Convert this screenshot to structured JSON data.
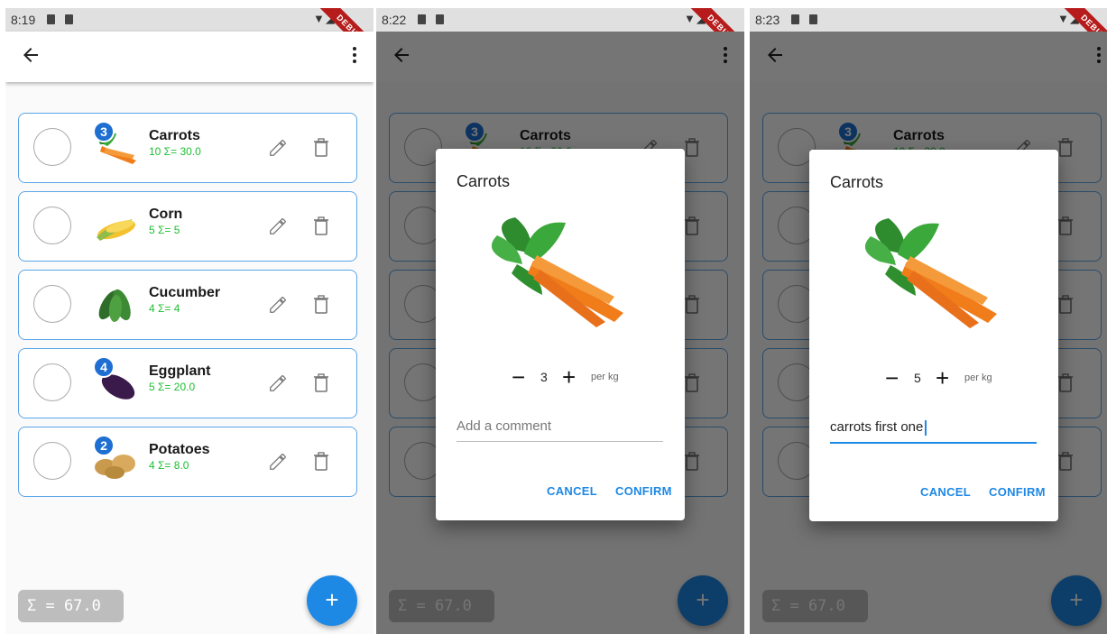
{
  "accent_color": "#1e88e5",
  "debug_banner": "DEBUG",
  "screens": [
    {
      "status_time": "8:19",
      "dimmed": false,
      "items": [
        {
          "name": "Carrots",
          "sub": "10  Σ= 30.0",
          "badge": "3",
          "image": "carrot-image"
        },
        {
          "name": "Corn",
          "sub": "5  Σ= 5",
          "badge": "",
          "image": "corn-image"
        },
        {
          "name": "Cucumber",
          "sub": "4  Σ= 4",
          "badge": "",
          "image": "cucumber-image"
        },
        {
          "name": "Eggplant",
          "sub": "5  Σ= 20.0",
          "badge": "4",
          "image": "eggplant-image"
        },
        {
          "name": "Potatoes",
          "sub": "4  Σ= 8.0",
          "badge": "2",
          "image": "potato-image"
        }
      ],
      "sum_label": "Σ = 67.0",
      "fab_label": "+"
    },
    {
      "status_time": "8:22",
      "dimmed": true,
      "sum_label": "Σ = 67.0",
      "fab_label": "+",
      "dialog": {
        "title": "Carrots",
        "minus": "−",
        "quantity": "3",
        "plus": "+",
        "unit": "per kg",
        "comment_placeholder": "Add a comment",
        "comment_value": "",
        "cancel_label": "CANCEL",
        "confirm_label": "CONFIRM"
      }
    },
    {
      "status_time": "8:23",
      "dimmed": true,
      "sum_label": "Σ = 67.0",
      "fab_label": "+",
      "dialog": {
        "title": "Carrots",
        "minus": "−",
        "quantity": "5",
        "plus": "+",
        "unit": "per kg",
        "comment_placeholder": "Add a comment",
        "comment_value": "carrots first one",
        "cancel_label": "CANCEL",
        "confirm_label": "CONFIRM"
      }
    }
  ]
}
